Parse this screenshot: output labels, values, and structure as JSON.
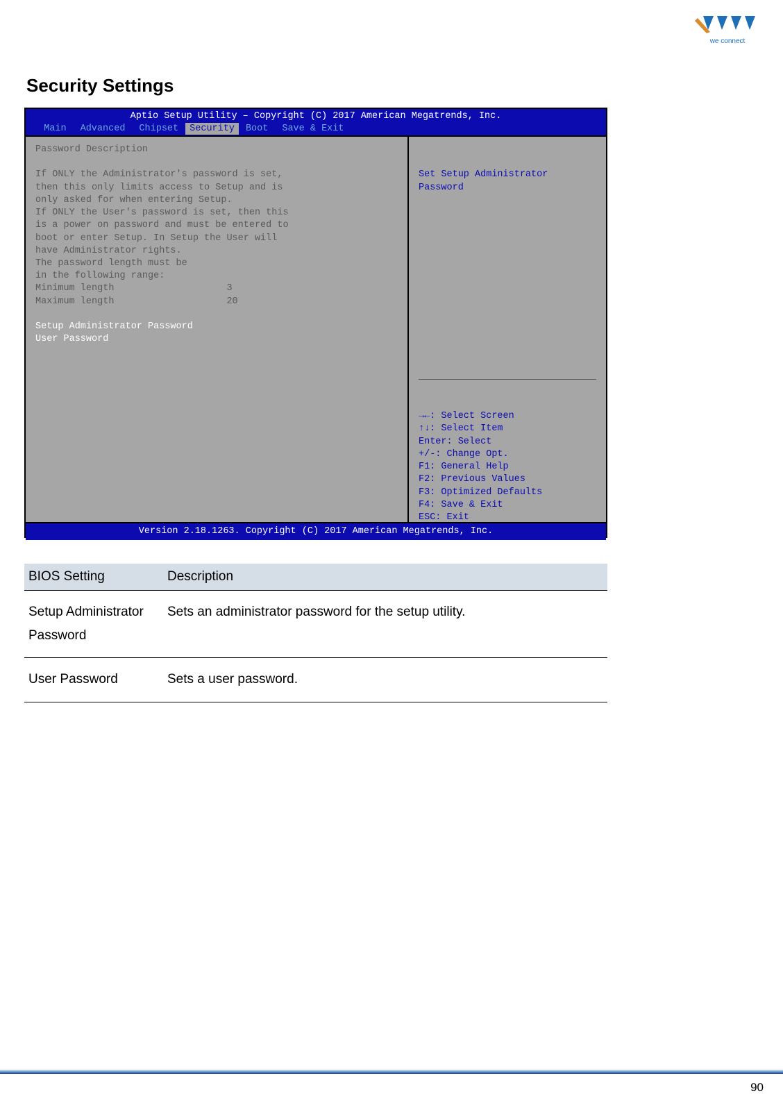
{
  "page_title": "Security Settings",
  "bios": {
    "utility_title": "Aptio Setup Utility – Copyright (C) 2017 American Megatrends, Inc.",
    "menu": {
      "items": [
        "Main",
        "Advanced",
        "Chipset",
        "Security",
        "Boot",
        "Save & Exit"
      ],
      "active_index": 3
    },
    "left_panel": {
      "intro_lines": [
        "Password Description",
        "",
        "If ONLY the Administrator's password is set,",
        "then this only limits access to Setup and is",
        "only asked for when entering Setup.",
        "If ONLY the User's password is set, then this",
        "is a power on password and must be entered to",
        "boot or enter Setup. In Setup the User will",
        "have Administrator rights.",
        "The password length must be",
        "in the following range:"
      ],
      "min_label": "Minimum length",
      "min_value": "3",
      "max_label": "Maximum length",
      "max_value": "20",
      "selectable_items": [
        "Setup Administrator Password",
        "User Password"
      ]
    },
    "right_panel": {
      "help_lines": [
        "Set Setup Administrator",
        "Password"
      ],
      "nav_lines": [
        "→←: Select Screen",
        "↑↓: Select Item",
        "Enter: Select",
        "+/-: Change Opt.",
        "F1: General Help",
        "F2: Previous Values",
        "F3: Optimized Defaults",
        "F4: Save & Exit",
        "ESC: Exit"
      ]
    },
    "footer": "Version 2.18.1263. Copyright (C) 2017 American Megatrends, Inc."
  },
  "table": {
    "headers": [
      "BIOS Setting",
      "Description"
    ],
    "rows": [
      {
        "setting": "Setup Administrator Password",
        "description": "Sets an administrator password for the setup utility."
      },
      {
        "setting": "User Password",
        "description": "Sets a user password."
      }
    ]
  },
  "page_number": "90"
}
